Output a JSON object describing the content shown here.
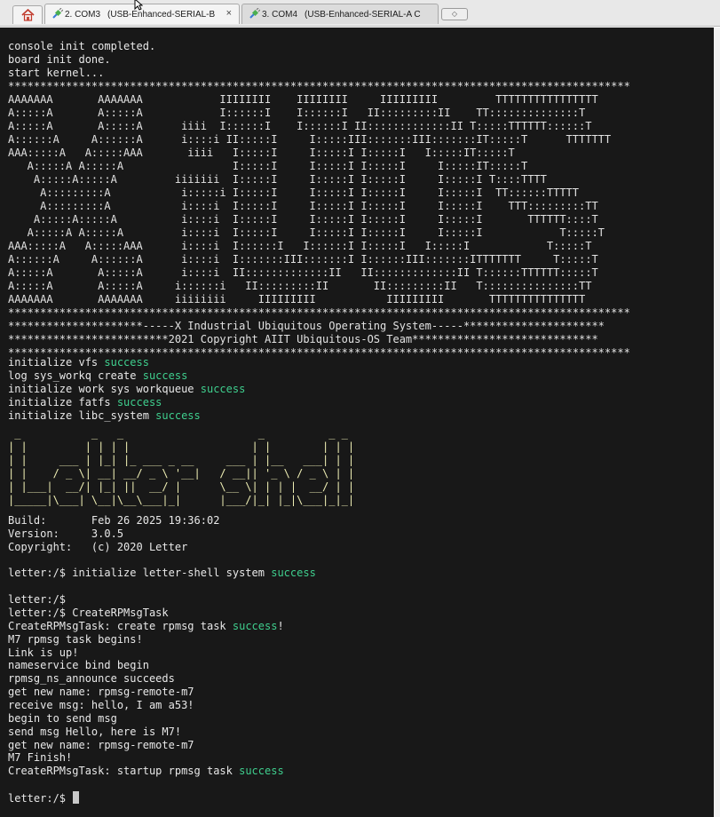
{
  "tabs": [
    {
      "label": "2. COM3",
      "title": "(USB-Enhanced-SERIAL-B",
      "close": "×",
      "active": true
    },
    {
      "label": "3. COM4",
      "title": "(USB-Enhanced-SERIAL-A C",
      "close": "",
      "active": false
    }
  ],
  "new_tab_glyph": "◇",
  "boot": [
    "console init completed.",
    "board init done.",
    "start kernel..."
  ],
  "banner": [
    "*************************************************************************************************",
    "AAAAAAA       AAAAAAA            IIIIIIII    IIIIIIII     IIIIIIIII         TTTTTTTTTTTTTTTT",
    "A:::::A       A:::::A            I::::::I    I::::::I   II:::::::::II    TT::::::::::::::T",
    "A:::::A       A:::::A      iiii  I::::::I    I::::::I II:::::::::::::II T:::::TTTTTT::::::T",
    "A::::::A     A::::::A      i::::i II:::::I     I:::::III:::::::III:::::::IT:::::T      TTTTTTT",
    "AAA:::::A   A:::::AAA       iiii   I:::::I     I:::::I I:::::I   I:::::IT:::::T",
    "   A:::::A A:::::A                 I:::::I     I:::::I I:::::I     I:::::IT:::::T",
    "    A:::::A:::::A         iiiiiii  I:::::I     I:::::I I:::::I     I:::::I T::::TTTT",
    "     A:::::::::A           i:::::i I:::::I     I:::::I I:::::I     I:::::I  TT::::::TTTTT",
    "     A:::::::::A           i::::i  I:::::I     I:::::I I:::::I     I:::::I    TTT:::::::::TT",
    "    A:::::A:::::A          i::::i  I:::::I     I:::::I I:::::I     I:::::I       TTTTTT::::T",
    "   A:::::A A:::::A         i::::i  I:::::I     I:::::I I:::::I     I:::::I            T:::::T",
    "AAA:::::A   A:::::AAA      i::::i  I::::::I   I::::::I I:::::I   I:::::I            T:::::T",
    "A::::::A     A::::::A      i::::i  I:::::::III:::::::I I::::::III:::::::ITTTTTTT     T:::::T",
    "A:::::A       A:::::A      i::::i  II:::::::::::::II   II:::::::::::::II T::::::TTTTTT:::::T",
    "A:::::A       A:::::A     i::::::i   II:::::::::II       II:::::::::II   T:::::::::::::::TT",
    "AAAAAAA       AAAAAAA     iiiiiiii     IIIIIIIII           IIIIIIIII       TTTTTTTTTTTTTTT",
    "*************************************************************************************************",
    "*********************-----X Industrial Ubiquitous Operating System-----**********************",
    "*************************2021 Copyright AIIT Ubiquitous-OS Team*****************************",
    "*************************************************************************************************"
  ],
  "init": [
    {
      "text": "initialize vfs ",
      "status": "success"
    },
    {
      "text": "log sys_workq create ",
      "status": "success"
    },
    {
      "text": "initialize work sys workqueue ",
      "status": "success"
    },
    {
      "text": "initialize fatfs ",
      "status": "success"
    },
    {
      "text": "initialize libc_system ",
      "status": "success"
    }
  ],
  "shell_logo": [
    " _           _   _                     _          _ _",
    "| |         | | | |                   | |        | | |",
    "| |     ___ | |_| |_ ___ _ __     ___ | |__   ___| | |",
    "| |    / _ \\| __| __/ _ \\ '__|   / __|| '_ \\ / _ \\ | |",
    "| |___|  __/| |_| ||  __/ |      \\__ \\| | | |  __/ | |",
    "|_____|\\___| \\__|\\__\\___|_|      |___/|_| |_|\\___|_|_|"
  ],
  "build_info": [
    "Build:       Feb 26 2025 19:36:02",
    "Version:     3.0.5",
    "Copyright:   (c) 2020 Letter"
  ],
  "shell_init": {
    "text": "letter:/$ initialize letter-shell system ",
    "status": "success"
  },
  "session": [
    {
      "text": "letter:/$"
    },
    {
      "text": "letter:/$ CreateRPMsgTask"
    },
    {
      "text": "CreateRPMsgTask: create rpmsg task ",
      "status": "success",
      "suffix": "!"
    },
    {
      "text": "M7 rpmsg task begins!"
    },
    {
      "text": "Link is up!"
    },
    {
      "text": "nameservice bind begin"
    },
    {
      "text": "rpmsg_ns_announce succeeds"
    },
    {
      "text": "get new name: rpmsg-remote-m7"
    },
    {
      "text": "receive msg: hello, I am a53!"
    },
    {
      "text": "begin to send msg"
    },
    {
      "text": "send msg Hello, here is M7!"
    },
    {
      "text": "get new name: rpmsg-remote-m7"
    },
    {
      "text": "M7 Finish!"
    },
    {
      "text": "CreateRPMsgTask: startup rpmsg task ",
      "status": "success"
    }
  ],
  "prompt": "letter:/$ ",
  "colors": {
    "terminal_bg": "#181818",
    "text": "#e8e8e8",
    "success": "#3fcf8e",
    "logo": "#eeeeb4"
  }
}
